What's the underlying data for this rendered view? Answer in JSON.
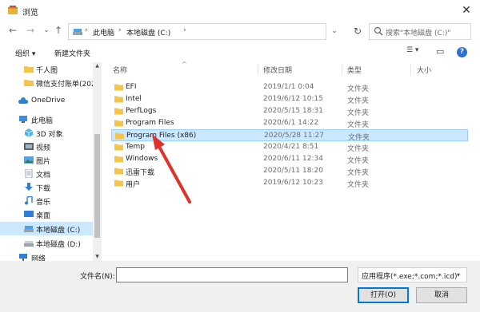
{
  "window": {
    "title": "浏览",
    "close_glyph": "✕"
  },
  "nav": {
    "back": "←",
    "forward": "→",
    "dropdown": "⌄",
    "up": "↑",
    "breadcrumb": [
      "此电脑",
      "本地磁盘 (C:)"
    ],
    "separator": "›",
    "address_dropdown": "⌄",
    "refresh": "↻",
    "search_placeholder": "搜索\"本地磁盘 (C:)\""
  },
  "toolbar": {
    "organize": "组织 ▾",
    "new_folder": "新建文件夹",
    "view_glyph": "☰ ▾",
    "pane_glyph": "▭",
    "help": "?"
  },
  "sidebar": {
    "items": [
      {
        "label": "千人图",
        "icon": "folder-icon"
      },
      {
        "label": "微信支付账单(202",
        "icon": "folder-icon"
      },
      {
        "label": "OneDrive",
        "icon": "cloud-icon"
      },
      {
        "label": "此电脑",
        "icon": "computer-icon"
      },
      {
        "label": "3D 对象",
        "icon": "3d-objects-icon"
      },
      {
        "label": "视频",
        "icon": "video-icon"
      },
      {
        "label": "图片",
        "icon": "pictures-icon"
      },
      {
        "label": "文档",
        "icon": "documents-icon"
      },
      {
        "label": "下载",
        "icon": "download-icon"
      },
      {
        "label": "音乐",
        "icon": "music-icon"
      },
      {
        "label": "桌面",
        "icon": "desktop-icon"
      },
      {
        "label": "本地磁盘 (C:)",
        "icon": "drive-icon"
      },
      {
        "label": "本地磁盘 (D:)",
        "icon": "drive-icon"
      },
      {
        "label": "网络",
        "icon": "network-icon"
      }
    ],
    "selected": "本地磁盘 (C:)"
  },
  "columns": {
    "name": "名称",
    "modified": "修改日期",
    "type": "类型",
    "size": "大小",
    "sort_caret": "^"
  },
  "files": [
    {
      "name": "EFI",
      "modified": "2019/1/1 0:04",
      "type": "文件夹"
    },
    {
      "name": "Intel",
      "modified": "2019/6/12 10:15",
      "type": "文件夹"
    },
    {
      "name": "PerfLogs",
      "modified": "2020/5/15 18:31",
      "type": "文件夹"
    },
    {
      "name": "Program Files",
      "modified": "2020/6/1 14:22",
      "type": "文件夹"
    },
    {
      "name": "Program Files (x86)",
      "modified": "2020/5/28 11:27",
      "type": "文件夹"
    },
    {
      "name": "Temp",
      "modified": "2020/4/21 8:51",
      "type": "文件夹"
    },
    {
      "name": "Windows",
      "modified": "2020/6/11 12:34",
      "type": "文件夹"
    },
    {
      "name": "迅雷下载",
      "modified": "2020/5/11 18:20",
      "type": "文件夹"
    },
    {
      "name": "用户",
      "modified": "2019/6/12 10:23",
      "type": "文件夹"
    }
  ],
  "selected_file": "Program Files (x86)",
  "footer": {
    "filename_label": "文件名(N):",
    "filename_value": "",
    "filetype": "应用程序(*.exe;*.com;*.icd)",
    "open_button": "打开(O)",
    "cancel_button": "取消"
  },
  "colors": {
    "selection": "#cce8ff",
    "selection_border": "#99d1ff",
    "folder": "#f3c54a",
    "arrow": "#e0322a",
    "accent": "#0078d7"
  }
}
